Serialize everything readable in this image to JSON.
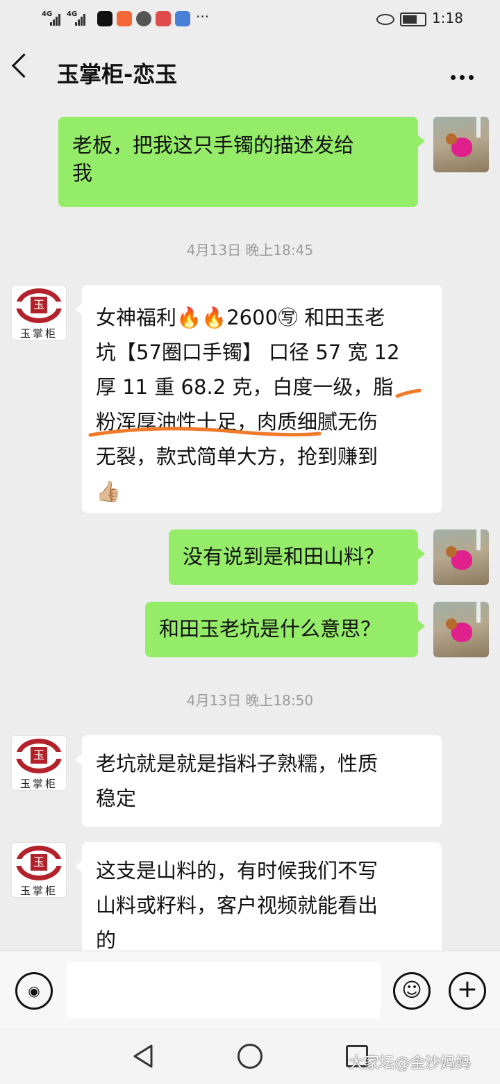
{
  "status_bar": {
    "signal_1_label": "4G",
    "signal_2_label": "4G",
    "time": "1:18",
    "more_indicator": "···",
    "icons": [
      "tiktok-icon",
      "app-icon",
      "message-icon",
      "reader-icon",
      "browser-icon",
      "eye-icon",
      "battery-icon"
    ]
  },
  "header": {
    "title": "玉掌柜-恋玉",
    "back_icon": "chevron-left-icon",
    "more_icon": "more-icon"
  },
  "messages": {
    "m1": {
      "lines": [
        "老板，把我这只手镯的描述发给",
        "我"
      ]
    },
    "ts1": "4月13日 晚上18:45",
    "m2": {
      "lines": [
        "女神福利🔥🔥2600㊢ 和田玉老",
        "坑【57圈口手镯】 口径 57 宽 12",
        "厚 11 重 68.2 克，白度一级，脂",
        "粉浑厚油性十足，肉质细腻无伤",
        "无裂，款式简单大方，抢到赚到",
        "👍🏼"
      ]
    },
    "m3": {
      "text": "没有说到是和田山料？"
    },
    "m4": {
      "text": "和田玉老坑是什么意思？"
    },
    "ts2": "4月13日 晚上18:50",
    "m5": {
      "lines": [
        "老坑就是就是指料子熟糯，性质",
        "稳定"
      ]
    },
    "m6": {
      "lines": [
        "这支是山料的，有时候我们不写",
        "山料或籽料，客户视频就能看出",
        "的"
      ]
    }
  },
  "shop_avatar": {
    "seal": "玉",
    "name": "玉掌柜"
  },
  "input_bar": {
    "value": "",
    "voice_icon": "voice-icon",
    "emoji_icon": "emoji-icon",
    "plus_icon": "plus-icon",
    "emoji_glyph": "☺",
    "plus_glyph": "+",
    "voice_glyph": "◉"
  },
  "watermark": "大家坛@金沙妈妈",
  "colors": {
    "outgoing_bubble": "#95ec69",
    "incoming_bubble": "#ffffff",
    "background": "#ededed",
    "underline_annotation": "#f07a2a"
  }
}
